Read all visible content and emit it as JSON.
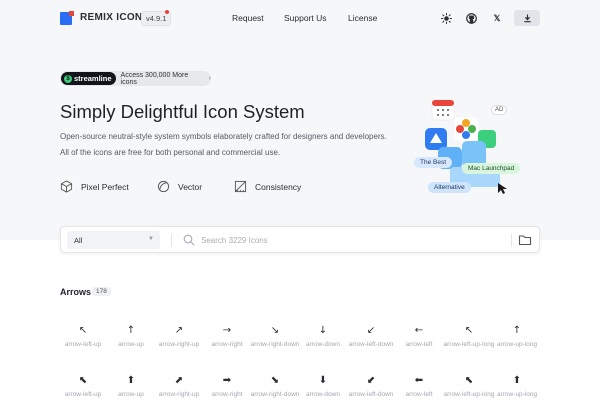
{
  "header": {
    "logo_text": "REMIX ICON",
    "version": "v4.9.1",
    "nav": [
      "Request",
      "Support Us",
      "License"
    ],
    "icons": [
      "sun-icon",
      "github-icon",
      "x-icon",
      "download-icon"
    ]
  },
  "promo": {
    "brand": "streamline",
    "text": "Access 300,000 More icons",
    "arrow": "›"
  },
  "hero": {
    "title": "Simply Delightful Icon System",
    "desc_line1": "Open-source neutral-style system symbols elaborately crafted for designers and developers.",
    "desc_line2": "All of the icons are free for both personal and commercial use."
  },
  "features": [
    "Pixel Perfect",
    "Vector",
    "Consistency"
  ],
  "ad": {
    "badge": "AD",
    "tags": [
      "The Best",
      "Mac Launchpad",
      "Alternative"
    ]
  },
  "search": {
    "category_selected": "All",
    "placeholder": "Search 3229 Icons"
  },
  "category": {
    "title": "Arrows",
    "count": "178"
  },
  "icons_row1": [
    {
      "name": "arrow-left-up",
      "glyph": "↖"
    },
    {
      "name": "arrow-up",
      "glyph": "↑"
    },
    {
      "name": "arrow-right-up",
      "glyph": "↗"
    },
    {
      "name": "arrow-right",
      "glyph": "→"
    },
    {
      "name": "arrow-right-down",
      "glyph": "↘"
    },
    {
      "name": "arrow-down",
      "glyph": "↓"
    },
    {
      "name": "arrow-left-down",
      "glyph": "↙"
    },
    {
      "name": "arrow-left",
      "glyph": "←"
    },
    {
      "name": "arrow-left-up-long",
      "glyph": "↖"
    },
    {
      "name": "arrow-up-long",
      "glyph": "↑"
    }
  ],
  "icons_row2": [
    {
      "name": "arrow-left-up",
      "glyph": "⬉"
    },
    {
      "name": "arrow-up",
      "glyph": "⬆"
    },
    {
      "name": "arrow-right-up",
      "glyph": "⬈"
    },
    {
      "name": "arrow-right",
      "glyph": "➡"
    },
    {
      "name": "arrow-right-down",
      "glyph": "⬊"
    },
    {
      "name": "arrow-down",
      "glyph": "⬇"
    },
    {
      "name": "arrow-left-down",
      "glyph": "⬋"
    },
    {
      "name": "arrow-left",
      "glyph": "⬅"
    },
    {
      "name": "arrow-left-up-long",
      "glyph": "⬉"
    },
    {
      "name": "arrow-up-long",
      "glyph": "⬆"
    }
  ],
  "colors": {
    "logo_blue": "#2a6df4",
    "logo_red": "#e8453c",
    "accent_green": "#3ccf7d"
  }
}
